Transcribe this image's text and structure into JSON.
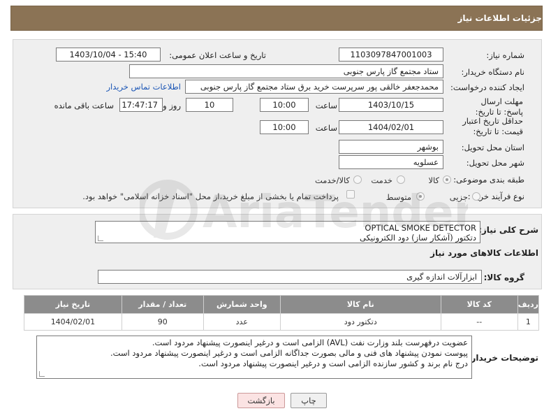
{
  "header": {
    "title": "جزئیات اطلاعات نیاز"
  },
  "fields": {
    "need_number_label": "شماره نیاز:",
    "need_number": "1103097847001003",
    "announce_label": "تاریخ و ساعت اعلان عمومی:",
    "announce_value": "1403/10/04 - 15:40",
    "buyer_org_label": "نام دستگاه خریدار:",
    "buyer_org": "ستاد مجتمع گاز پارس جنوبی",
    "requester_label": "ایجاد کننده درخواست:",
    "requester": "محمدجعفر خالقی پور سرپرست خرید برق ستاد مجتمع گاز پارس جنوبی",
    "contact_link": "اطلاعات تماس خریدار",
    "deadline_label": "مهلت ارسال پاسخ: تا تاریخ:",
    "deadline_date": "1403/10/15",
    "time_label": "ساعت",
    "deadline_time": "10:00",
    "days_value": "10",
    "days_label": "روز و",
    "remaining_time": "17:47:17",
    "remaining_label": "ساعت باقی مانده",
    "validity_label": "حداقل تاریخ اعتبار قیمت: تا تاریخ:",
    "validity_date": "1404/02/01",
    "validity_time": "10:00",
    "province_label": "استان محل تحویل:",
    "province": "بوشهر",
    "city_label": "شهر محل تحویل:",
    "city": "عسلویه",
    "category_label": "طبقه بندی موضوعی:",
    "category_options": [
      "کالا",
      "خدمت",
      "کالا/خدمت"
    ],
    "process_label": "نوع فرآیند خرید :",
    "process_options": [
      "جزیی",
      "متوسط"
    ],
    "payment_note": "پرداخت تمام یا بخشی از مبلغ خرید،از محل \"اسناد خزانه اسلامی\" خواهد بود."
  },
  "description": {
    "label": "شرح کلی نیاز:",
    "line1": "OPTICAL SMOKE DETECTOR",
    "line2": "دتکتور (آشکار ساز) دود الکترونیکی"
  },
  "goods": {
    "section_title": "اطلاعات کالاهای مورد نیاز",
    "group_label": "گروه کالا:",
    "group_value": "ابزارآلات اندازه گیری"
  },
  "table": {
    "headers": [
      "ردیف",
      "کد کالا",
      "نام کالا",
      "واحد شمارش",
      "تعداد / مقدار",
      "تاریخ نیاز"
    ],
    "rows": [
      [
        "1",
        "--",
        "دتکتور دود",
        "عدد",
        "90",
        "1404/02/01"
      ]
    ]
  },
  "buyer_notes": {
    "label": "توضیحات خریدار:",
    "line1": "عضویت درفهرست بلند وزارت نفت (AVL) الزامی است و درغیر اینصورت پیشنهاد مردود است.",
    "line2": "پیوست نمودن پیشنهاد های فنی و مالی بصورت جداگانه الزامی است و درغیر اینصورت پیشنهاد مردود است.",
    "line3": "درج نام برند و کشور سازنده الزامی است و درغیر اینصورت پیشنهاد مردود است."
  },
  "buttons": {
    "print": "چاپ",
    "back": "بازگشت"
  },
  "watermark_text": "AriaTender.neT",
  "colors": {
    "header_bg": "#8b7355",
    "table_header_bg": "#8c8c8c",
    "link": "#1a55b5",
    "back_button_bg": "#fbe3e3"
  }
}
